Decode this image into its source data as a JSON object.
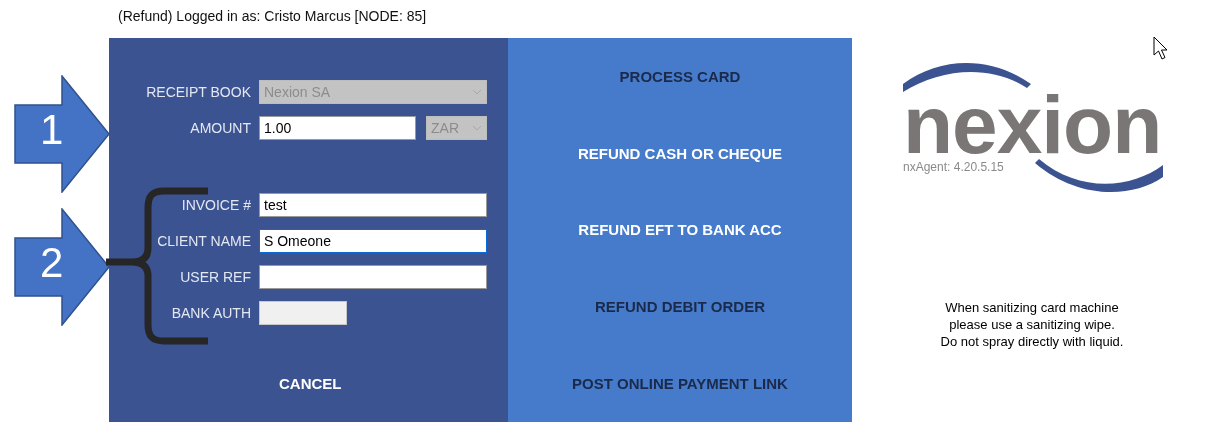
{
  "header": {
    "title": "(Refund) Logged in as: Cristo Marcus [NODE: 85]"
  },
  "form": {
    "receipt_book": {
      "label": "RECEIPT BOOK",
      "value": "Nexion SA",
      "disabled": true
    },
    "amount": {
      "label": "AMOUNT",
      "value": "1.00",
      "currency": {
        "value": "ZAR",
        "disabled": true
      }
    },
    "reference_fields": [
      {
        "kind": "text",
        "label": "INVOICE #",
        "value": "test",
        "focused": false,
        "disabled": false
      },
      {
        "kind": "text",
        "label": "CLIENT NAME",
        "value": "S Omeone",
        "focused": true,
        "disabled": false
      },
      {
        "kind": "text",
        "label": "USER REF",
        "focused": false,
        "disabled": false
      },
      {
        "kind": "short",
        "label": "BANK AUTH",
        "focused": false,
        "disabled": true
      }
    ],
    "cancel": {
      "label": "CANCEL"
    }
  },
  "actions": [
    {
      "label": "PROCESS CARD",
      "disabled": true
    },
    {
      "label": "REFUND CASH OR CHEQUE",
      "disabled": false
    },
    {
      "label": "REFUND EFT TO BANK ACC",
      "disabled": false
    },
    {
      "label": "REFUND DEBIT ORDER",
      "disabled": true
    },
    {
      "label": "POST ONLINE PAYMENT LINK",
      "disabled": true
    }
  ],
  "logo": {
    "wordmark": "nexion",
    "version": "nxAgent: 4.20.5.15"
  },
  "notice": [
    "When sanitizing card machine",
    "please use a sanitizing wipe.",
    "Do not spray directly with liquid."
  ],
  "annotations": [
    {
      "label": "1"
    },
    {
      "label": "2"
    }
  ]
}
